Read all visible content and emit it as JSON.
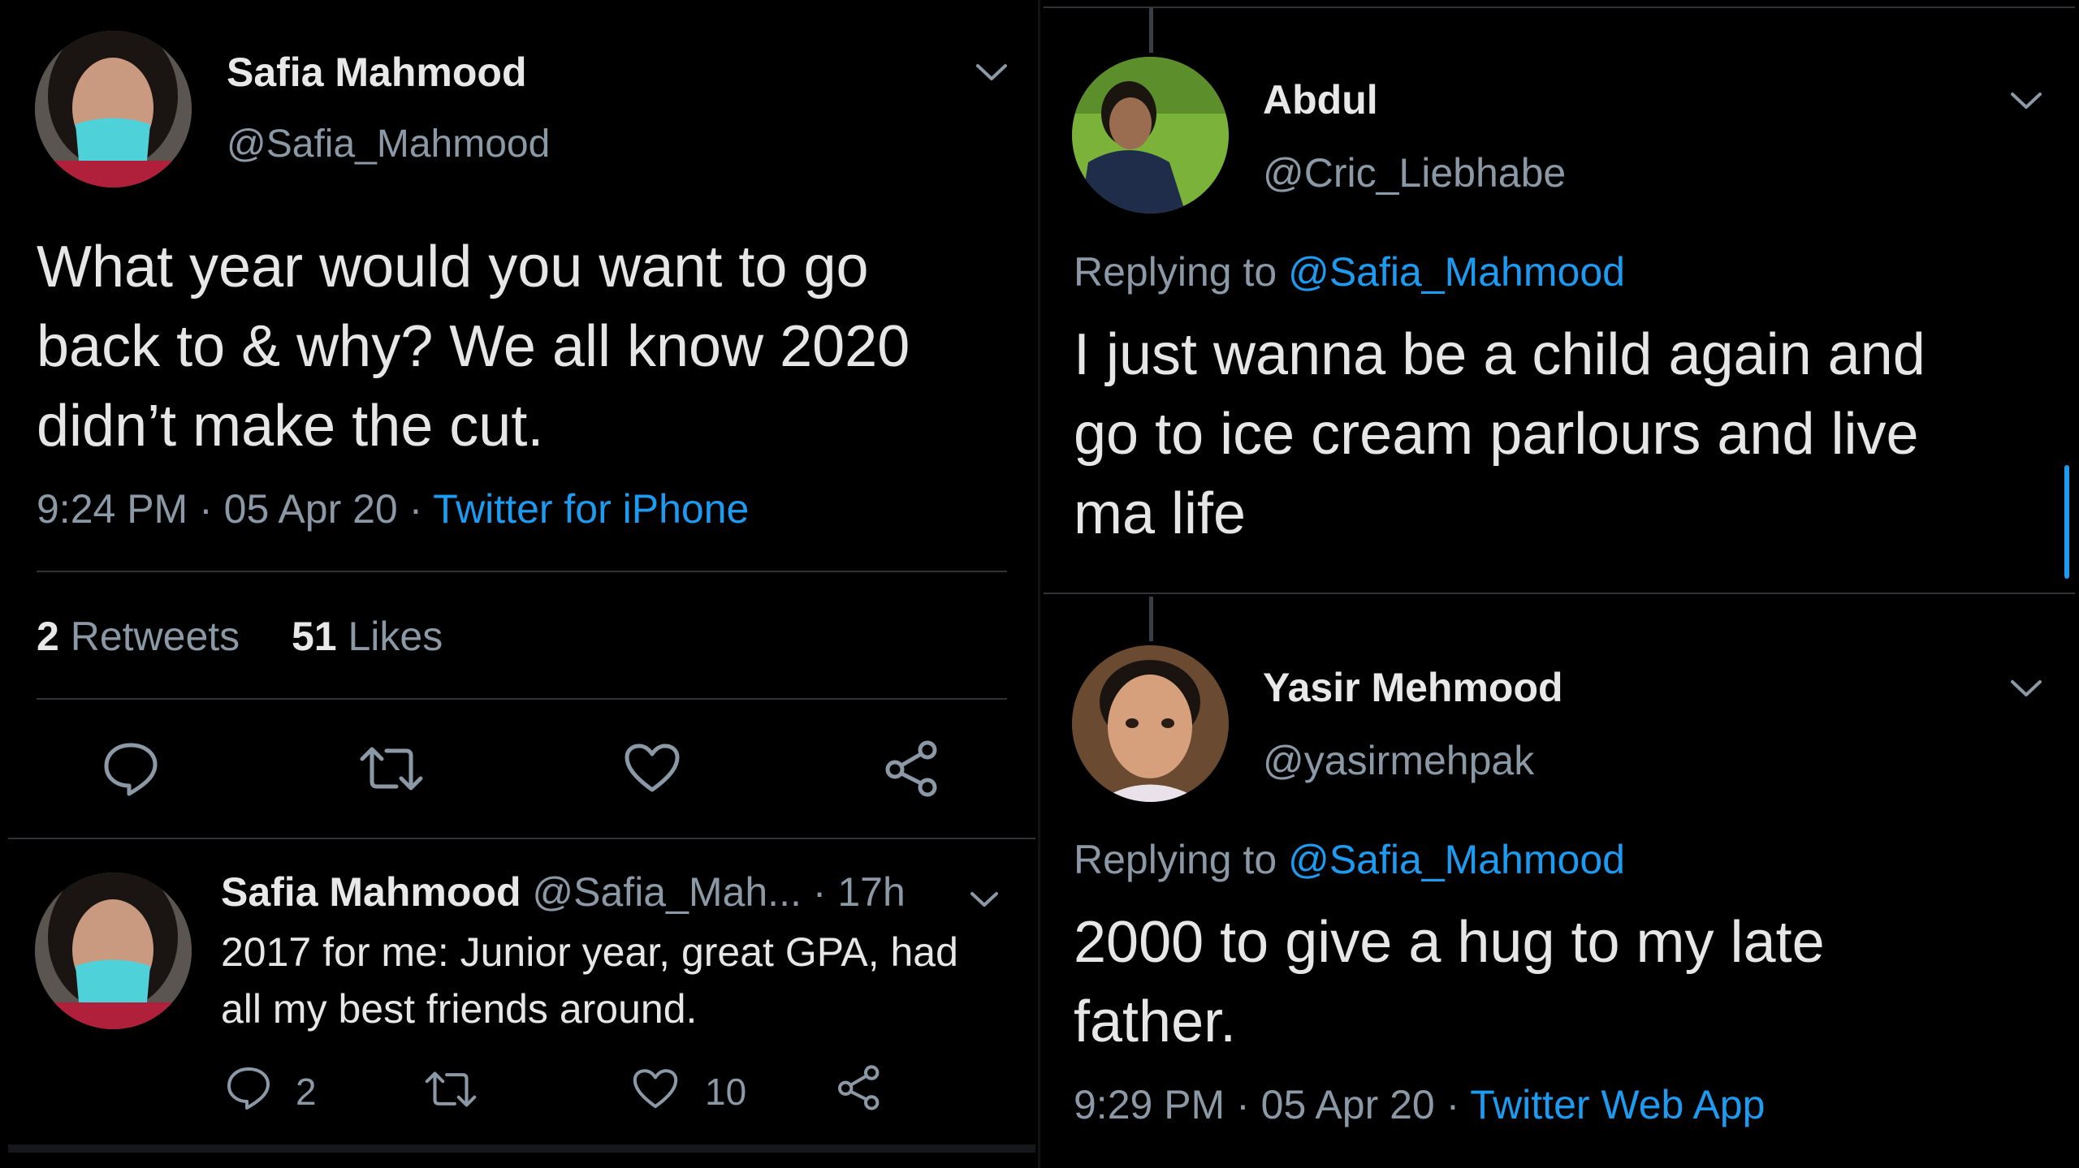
{
  "left_main_tweet": {
    "name": "Safia Mahmood",
    "handle": "@Safia_Mahmood",
    "text_lines": [
      "What year would you want to go",
      "back to & why? We all know 2020",
      "didn’t make the cut."
    ],
    "time": "9:24 PM",
    "date": "05 Apr 20",
    "source": "Twitter for iPhone",
    "retweets_count": "2",
    "retweets_label": "Retweets",
    "likes_count": "51",
    "likes_label": "Likes"
  },
  "left_reply": {
    "name": "Safia Mahmood",
    "handle": "@Safia_Mah...",
    "age": "17h",
    "text_lines": [
      "2017 for me: Junior year, great GPA, had",
      "all my best friends around."
    ],
    "reply_count": "2",
    "like_count": "10"
  },
  "right_reply_1": {
    "name": "Abdul",
    "handle": "@Cric_Liebhabe",
    "replying_prefix": "Replying to",
    "replying_to": "@Safia_Mahmood",
    "text_lines": [
      "I just wanna be a child again and",
      "go to ice cream parlours and live",
      "ma life"
    ]
  },
  "right_reply_2": {
    "name": "Yasir Mehmood",
    "handle": "@yasirmehpak",
    "replying_prefix": "Replying to",
    "replying_to": "@Safia_Mahmood",
    "text_lines": [
      "2000 to give a hug to my late",
      "father."
    ],
    "time": "9:29 PM",
    "date": "05 Apr 20",
    "source": "Twitter Web App"
  },
  "colors": {
    "background": "#000000",
    "link": "#1d9bf0",
    "secondary": "#8b98a5",
    "divider": "#2f3336"
  },
  "icons": [
    "chevron-down-icon",
    "reply-icon",
    "retweet-icon",
    "like-icon",
    "share-icon"
  ]
}
